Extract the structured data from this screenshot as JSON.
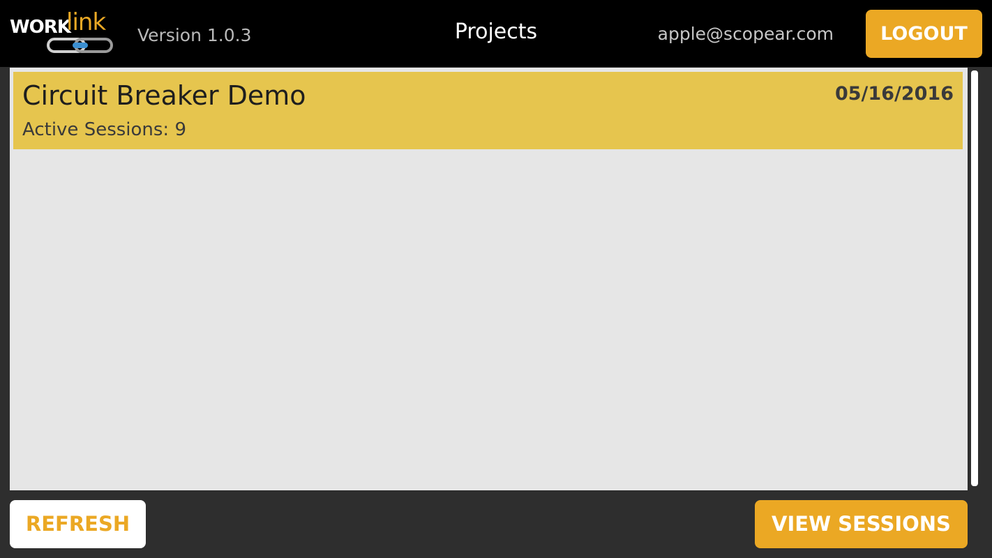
{
  "header": {
    "logo_text_1": "WORK",
    "logo_text_2": "link",
    "version": "Version 1.0.3",
    "title": "Projects",
    "user_email": "apple@scopear.com",
    "logout_label": "LOGOUT"
  },
  "projects": [
    {
      "name": "Circuit Breaker Demo",
      "date": "05/16/2016",
      "sessions": "Active Sessions: 9",
      "selected": true
    }
  ],
  "footer": {
    "refresh_label": "REFRESH",
    "view_sessions_label": "VIEW SESSIONS"
  },
  "colors": {
    "accent": "#eba824",
    "selected_row": "#e6c54e",
    "header_bg": "#000000",
    "list_bg": "#e6e6e6",
    "page_bg": "#2e2e2e"
  }
}
